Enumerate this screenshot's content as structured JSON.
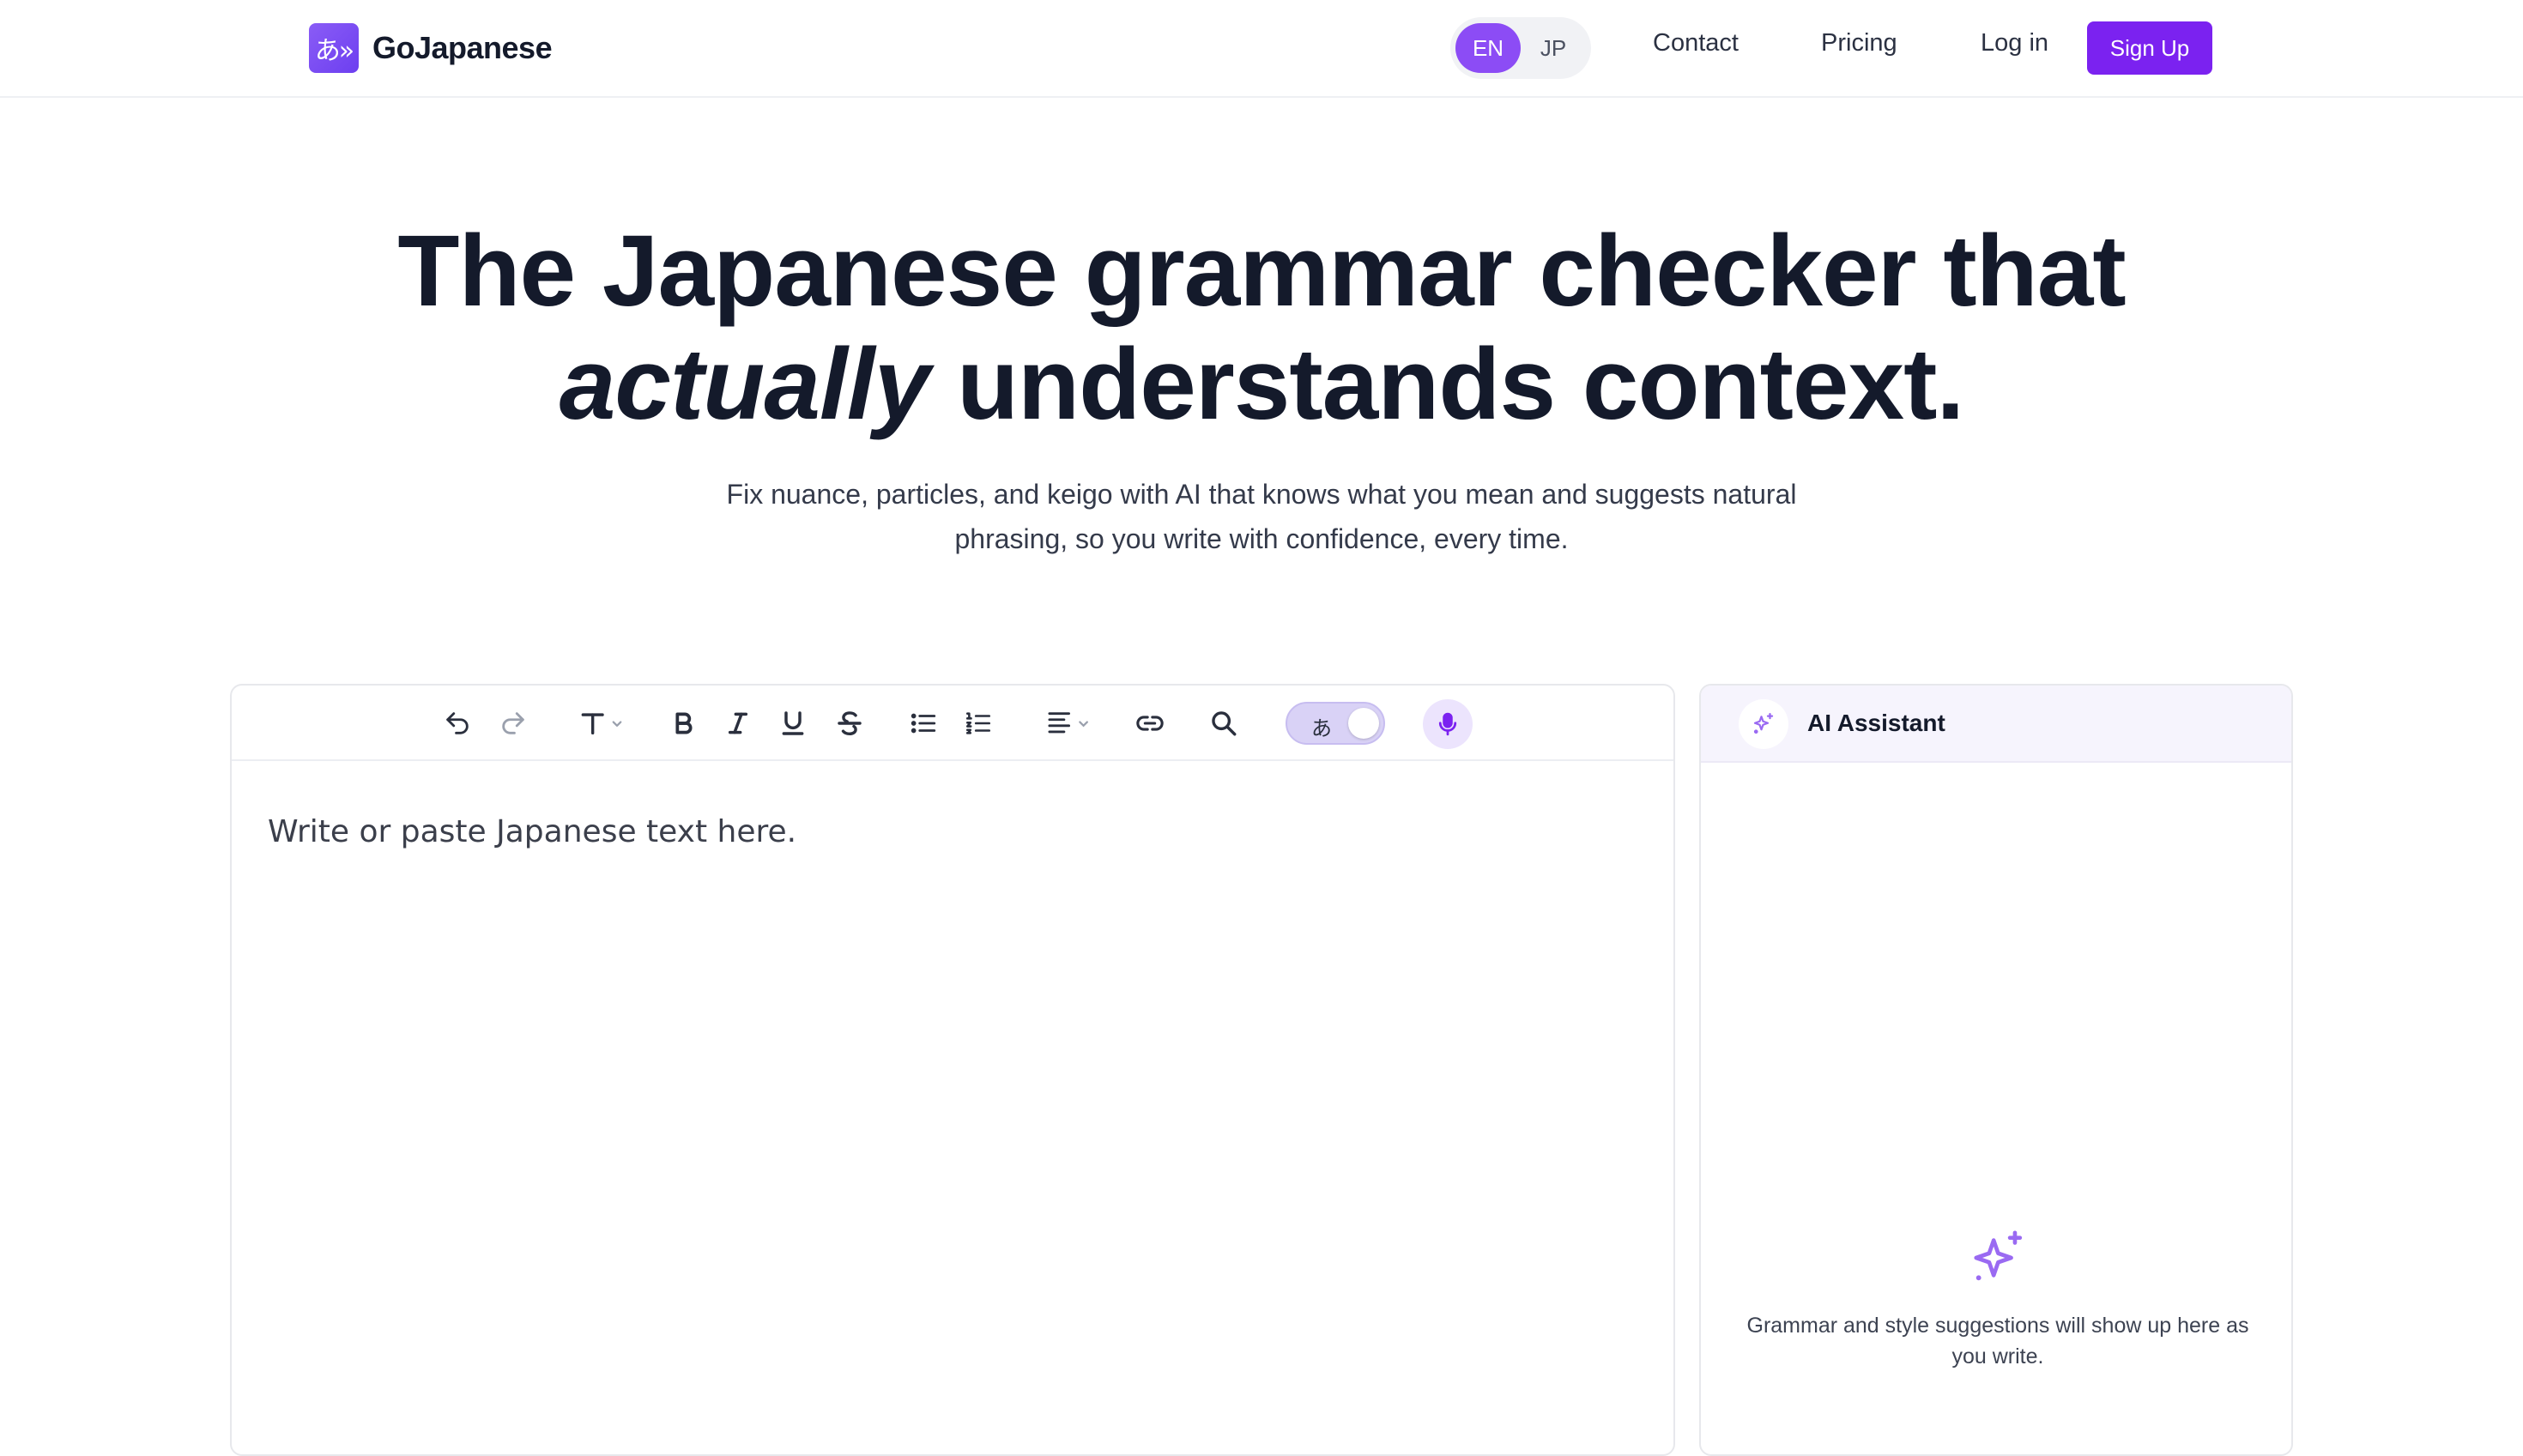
{
  "nav": {
    "brand_name": "GoJapanese",
    "brand_logo_text": "あ»",
    "lang_en": "EN",
    "lang_jp": "JP",
    "lang_active": "EN",
    "contact": "Contact",
    "pricing": "Pricing",
    "login": "Log in",
    "signup": "Sign Up"
  },
  "hero": {
    "title_line1": "The Japanese grammar checker that",
    "title_emph": "actually",
    "title_line2_rest": " understands context.",
    "subtitle_line1": "Fix nuance, particles, and keigo with AI that knows what you mean and suggests natural",
    "subtitle_line2": "phrasing, so you write with confidence, every time."
  },
  "editor": {
    "placeholder": "Write or paste Japanese text here.",
    "toolbar": [
      "undo-icon",
      "redo-icon",
      "text-style-icon",
      "bold-icon",
      "italic-icon",
      "underline-icon",
      "strikethrough-icon",
      "bullet-list-icon",
      "numbered-list-icon",
      "align-icon",
      "link-icon",
      "search-icon",
      "ime-toggle",
      "microphone-icon"
    ],
    "ime_char": "あ",
    "ime_enabled": true
  },
  "ai_panel": {
    "title": "AI Assistant",
    "empty_text": "Grammar and style suggestions will show up here as you write."
  },
  "colors": {
    "accent": "#7b22f0",
    "accent_light": "#8c4cf5",
    "text": "#141a2b",
    "sparkle": "#9a6af2"
  }
}
